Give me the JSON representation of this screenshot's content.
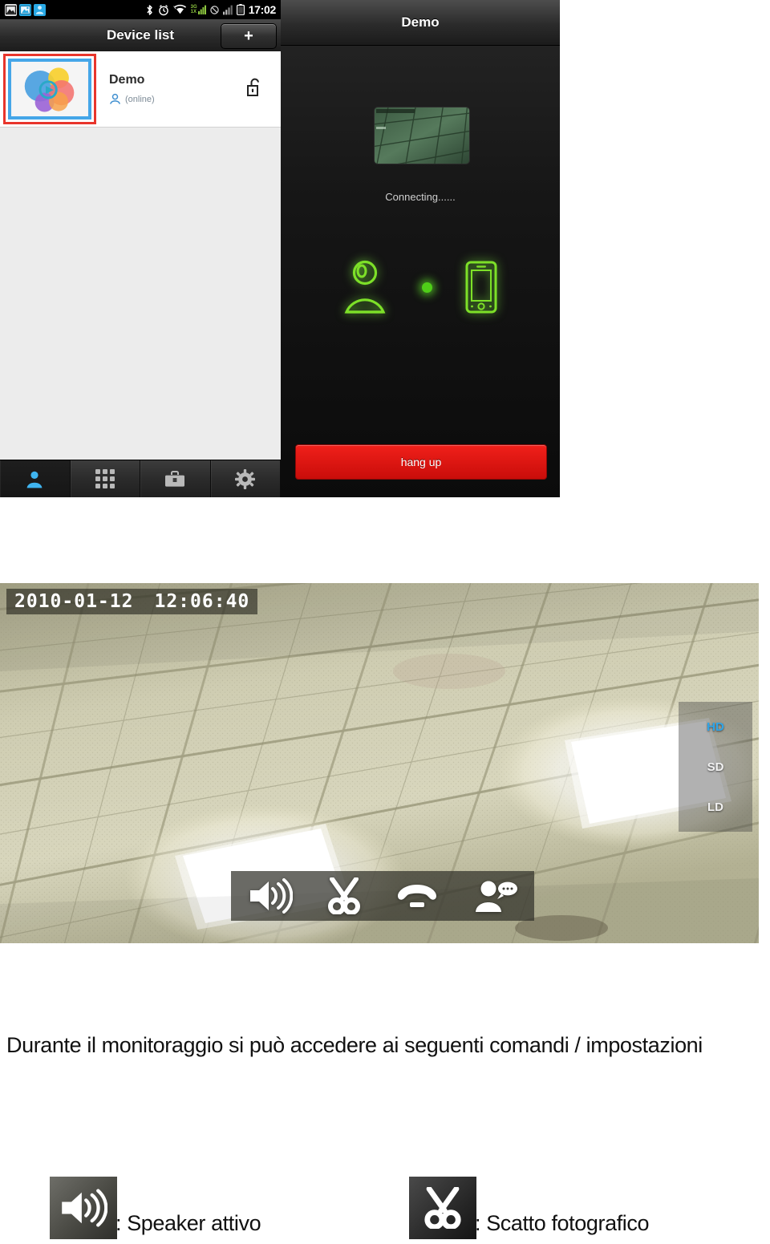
{
  "phone": {
    "status_bar": {
      "icons": [
        "gallery-icon",
        "screenshot-icon",
        "contact-icon",
        "bluetooth-icon",
        "alarm-icon",
        "wifi-icon",
        "data-3g-icon",
        "mute-icon",
        "signal-icon",
        "battery-icon"
      ],
      "network_top_label": "3G",
      "network_bottom_label": "1X",
      "clock": "17:02"
    },
    "device_list_screen": {
      "title": "Device list",
      "add_button_label": "+",
      "devices": [
        {
          "name": "Demo",
          "status": "(online)",
          "lock_state": "unlocked",
          "selected": true
        }
      ],
      "tabs": [
        {
          "name": "contacts",
          "icon": "person-icon",
          "active": true
        },
        {
          "name": "keypad",
          "icon": "grid-icon",
          "active": false
        },
        {
          "name": "tools",
          "icon": "toolbox-icon",
          "active": false
        },
        {
          "name": "settings",
          "icon": "gear-icon",
          "active": false
        }
      ]
    },
    "call_screen": {
      "title": "Demo",
      "connecting_text": "Connecting......",
      "caller_icon": "person-icon",
      "callee_icon": "smartphone-icon",
      "hang_up_label": "hang up"
    }
  },
  "camera_view": {
    "timestamp_date": "2010-01-12",
    "timestamp_time": "12:06:40",
    "quality_options": [
      {
        "label": "HD",
        "selected": true
      },
      {
        "label": "SD",
        "selected": false
      },
      {
        "label": "LD",
        "selected": false
      }
    ],
    "toolbar": [
      {
        "name": "speaker-icon",
        "label": "speaker"
      },
      {
        "name": "scissors-icon",
        "label": "snapshot"
      },
      {
        "name": "phone-hangup-icon",
        "label": "hang up"
      },
      {
        "name": "talk-icon",
        "label": "talk"
      }
    ]
  },
  "caption": "Durante il monitoraggio si può accedere ai seguenti comandi / impostazioni",
  "legend": [
    {
      "icon": "speaker-icon",
      "label": ": Speaker attivo"
    },
    {
      "icon": "scissors-icon",
      "label": ": Scatto fotografico"
    }
  ],
  "colors": {
    "accent_blue": "#2fa5e8",
    "selection_red": "#e8352c",
    "thumb_border_blue": "#45a6e8",
    "hang_up_red": "#e8110c",
    "call_green": "#7de028",
    "status_text": "#7d8b97"
  }
}
